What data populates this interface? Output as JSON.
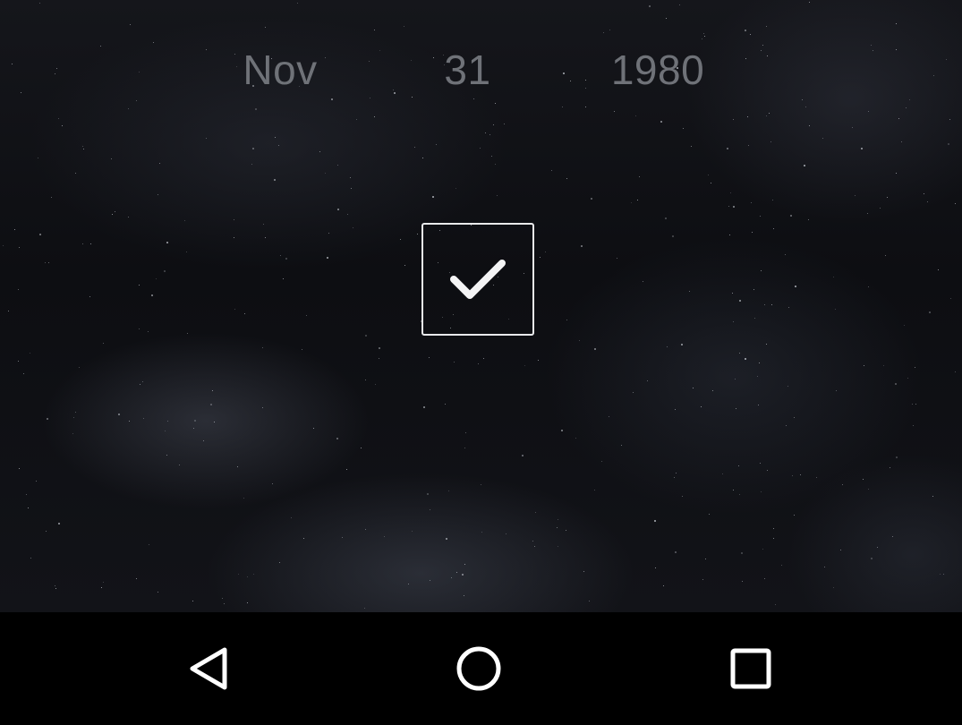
{
  "date_picker": {
    "month": "Nov",
    "day": "31",
    "year": "1980"
  },
  "confirm": {
    "icon": "checkmark-icon"
  },
  "nav_bar": {
    "back_icon": "back-triangle-icon",
    "home_icon": "home-circle-icon",
    "recent_icon": "recent-apps-square-icon"
  },
  "colors": {
    "date_text": "#6f7278",
    "button_border": "#e9eaec",
    "nav_background": "#000000",
    "nav_icon": "#ffffff"
  }
}
